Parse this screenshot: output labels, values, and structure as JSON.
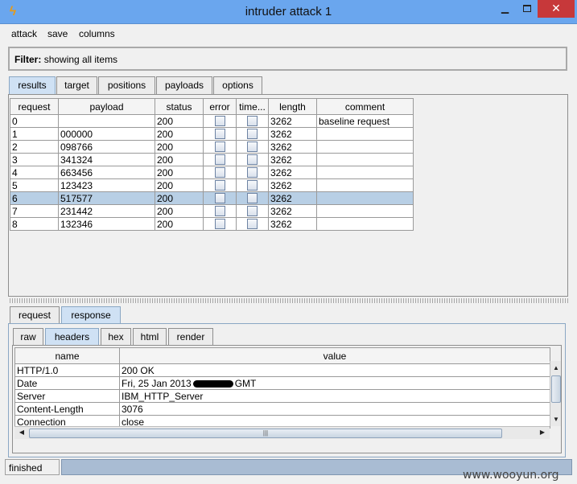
{
  "window": {
    "title": "intruder attack 1",
    "icon": "burp-lightning-icon"
  },
  "menu": [
    "attack",
    "save",
    "columns"
  ],
  "filter": {
    "label": "Filter:",
    "value": "showing all items"
  },
  "tabs": [
    "results",
    "target",
    "positions",
    "payloads",
    "options"
  ],
  "active_tab": "results",
  "results": {
    "columns": [
      "request",
      "payload",
      "status",
      "error",
      "time...",
      "length",
      "comment"
    ],
    "rows": [
      {
        "request": "0",
        "payload": "",
        "status": "200",
        "length": "3262",
        "comment": "baseline request"
      },
      {
        "request": "1",
        "payload": "000000",
        "status": "200",
        "length": "3262",
        "comment": ""
      },
      {
        "request": "2",
        "payload": "098766",
        "status": "200",
        "length": "3262",
        "comment": ""
      },
      {
        "request": "3",
        "payload": "341324",
        "status": "200",
        "length": "3262",
        "comment": ""
      },
      {
        "request": "4",
        "payload": "663456",
        "status": "200",
        "length": "3262",
        "comment": ""
      },
      {
        "request": "5",
        "payload": "123423",
        "status": "200",
        "length": "3262",
        "comment": ""
      },
      {
        "request": "6",
        "payload": "517577",
        "status": "200",
        "length": "3262",
        "comment": ""
      },
      {
        "request": "7",
        "payload": "231442",
        "status": "200",
        "length": "3262",
        "comment": ""
      },
      {
        "request": "8",
        "payload": "132346",
        "status": "200",
        "length": "3262",
        "comment": ""
      }
    ],
    "selected_request": "6"
  },
  "detail_tabs": [
    "request",
    "response"
  ],
  "active_detail_tab": "response",
  "response_tabs": [
    "raw",
    "headers",
    "hex",
    "html",
    "render"
  ],
  "active_response_tab": "headers",
  "headers": {
    "columns": [
      "name",
      "value"
    ],
    "rows": [
      {
        "name": "HTTP/1.0",
        "value": "200 OK"
      },
      {
        "name": "Date",
        "value": "Fri, 25 Jan 2013",
        "value_suffix": "GMT"
      },
      {
        "name": "Server",
        "value": "IBM_HTTP_Server"
      },
      {
        "name": "Content-Length",
        "value": "3076"
      },
      {
        "name": "Connection",
        "value": "close"
      }
    ]
  },
  "status": {
    "text": "finished"
  },
  "watermark": "www.wooyun.org",
  "colors": {
    "titlebar": "#6aa6ee",
    "close_button": "#c7383a",
    "selected_row": "#b8cfe5",
    "progress": "#a9bcd3"
  }
}
